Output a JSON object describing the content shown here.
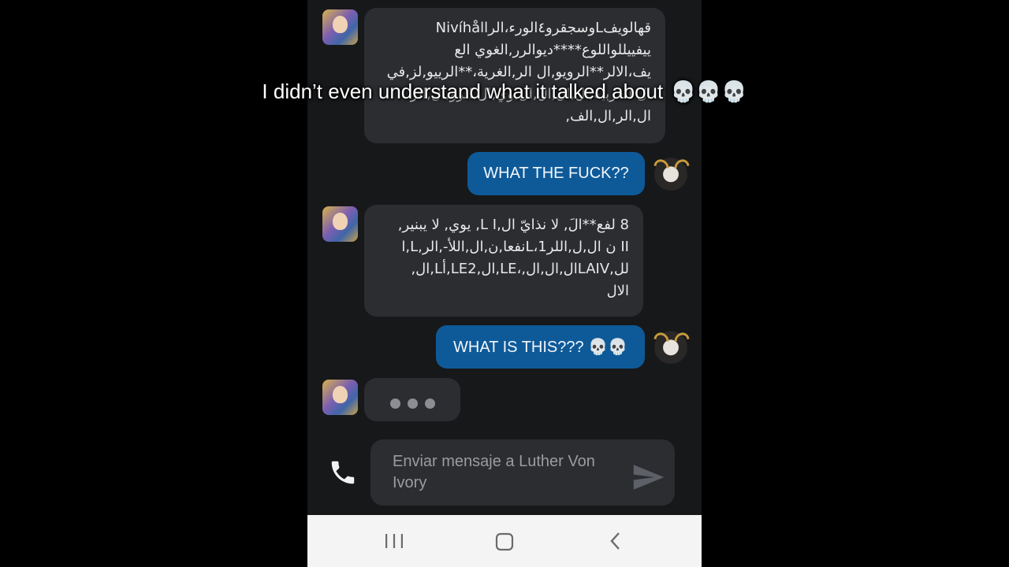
{
  "caption": {
    "text": "I didn’t even understand what it talked about",
    "emojis": "💀💀💀"
  },
  "chat": {
    "messages": [
      {
        "sender": "bot",
        "lines": [
          "قهالويفLوسجقرو٤الورء،الرNivíhåll",
          "ييفييللواللوع****ديوالرر,الغوي الع",
          "يف،الالر**الرويو,ال الر,الغرية،**الرييو,لز,في",
          "ال الغربية,ال,ال,ال,ال,وي,ال,الرو,ال,الر",
          "ال,الر,ال,الف,"
        ]
      },
      {
        "sender": "user",
        "text": "WHAT THE FUCK??"
      },
      {
        "sender": "bot",
        "lines": [
          "8 لفع**الَ, لا نذايّ ال,L I, يوي, لا يبنير,",
          "II ن ال,ل,اللر1،Lنفعا,ن,ال,اللأ-,الر,L,ا",
          "لل,LAIVال,ال,ال,،LE,ال,LE2,أL,ال,",
          "الال"
        ]
      },
      {
        "sender": "user",
        "text": "WHAT IS THIS??? 💀💀"
      },
      {
        "sender": "bot",
        "typing": true
      }
    ]
  },
  "composer": {
    "placeholder": "Enviar mensaje a Luther Von Ivory",
    "call_icon": "phone-icon",
    "send_icon": "send-icon"
  },
  "navbar": {
    "icons": [
      "recents-icon",
      "home-icon",
      "back-icon"
    ]
  },
  "colors": {
    "background": "#17181a",
    "bot_bubble": "#2b2d31",
    "user_bubble": "#0e5a99",
    "navbar": "#f4f4f4"
  }
}
